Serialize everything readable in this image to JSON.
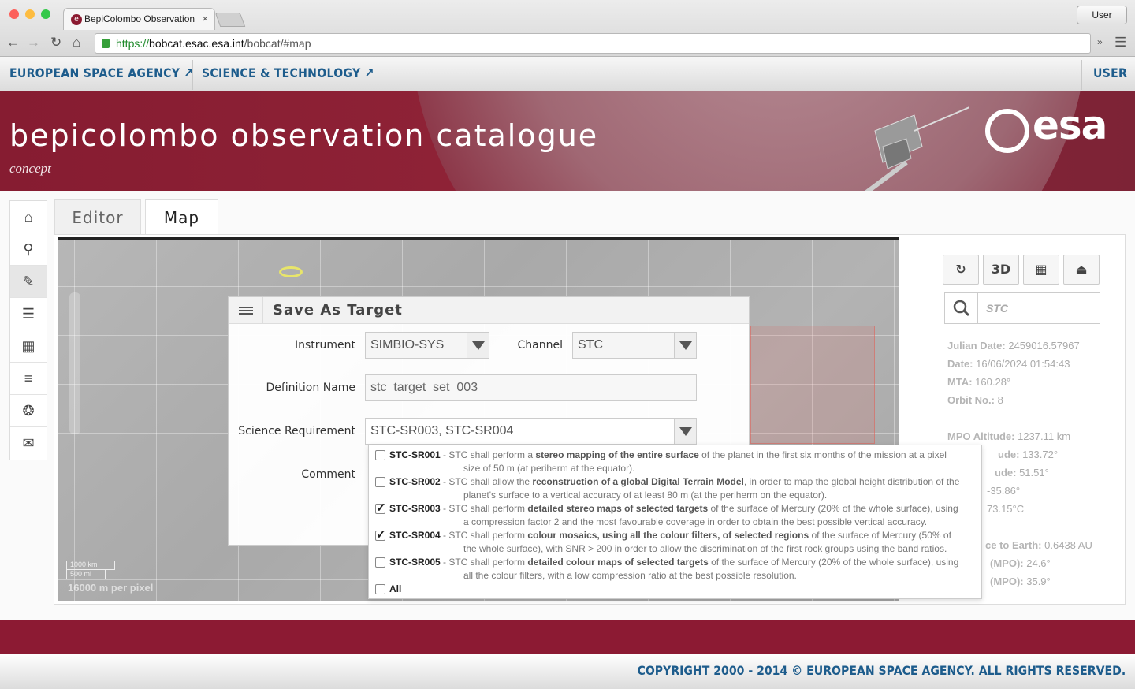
{
  "browser": {
    "tab_title": "BepiColombo Observation",
    "tab_close": "×",
    "user_button": "User",
    "url_protocol": "https://",
    "url_host": "bobcat.esac.esa.int",
    "url_path": "/bobcat/#map",
    "overflow": "»"
  },
  "esa_bar": {
    "link1": "EUROPEAN SPACE AGENCY",
    "link2": "SCIENCE & TECHNOLOGY",
    "user": "USER"
  },
  "banner": {
    "title": "bepicolombo observation catalogue",
    "subtitle": "concept",
    "logo_text": "esa"
  },
  "tabs": {
    "editor": "Editor",
    "map": "Map"
  },
  "sidenav": {
    "icons": [
      "home-icon",
      "search-icon",
      "pencil-icon",
      "list-icon",
      "dashboard-icon",
      "sliders-icon",
      "lifebuoy-icon",
      "mail-icon"
    ]
  },
  "map": {
    "scale_km": "1000 km",
    "scale_mi": "500 mi",
    "resolution": "16000 m per pixel"
  },
  "dialog": {
    "title": "Save As Target",
    "instrument_label": "Instrument",
    "instrument_value": "SIMBIO-SYS",
    "channel_label": "Channel",
    "channel_value": "STC",
    "definition_label": "Definition Name",
    "definition_value": "stc_target_set_003",
    "science_label": "Science Requirement",
    "science_value": "STC-SR003, STC-SR004",
    "comment_label": "Comment"
  },
  "requirements": [
    {
      "code": "STC-SR001",
      "checked": false,
      "pre": " - STC shall perform a ",
      "hl": "stereo mapping of the entire surface",
      "post": " of the planet in the first six months of the mission at a pixel",
      "cont": "size of 50 m (at periherm at the equator)."
    },
    {
      "code": "STC-SR002",
      "checked": false,
      "pre": " - STC shall allow the ",
      "hl": "reconstruction of a global Digital Terrain Model",
      "post": ", in order to map the global height distribution of the",
      "cont": "planet's surface to a vertical accuracy of at least 80 m (at the periherm on the equator)."
    },
    {
      "code": "STC-SR003",
      "checked": true,
      "pre": " - STC shall perform ",
      "hl": "detailed stereo maps of selected targets",
      "post": " of the surface of Mercury (20% of the whole surface), using",
      "cont": "a compression factor 2 and the most favourable coverage in order to obtain the best possible vertical accuracy."
    },
    {
      "code": "STC-SR004",
      "checked": true,
      "pre": " - STC shall perform ",
      "hl": "colour mosaics, using all the colour filters, of selected regions",
      "post": " of the surface of Mercury (50% of",
      "cont": "the whole surface), with SNR > 200 in order to allow the discrimination of the first rock groups using the band ratios."
    },
    {
      "code": "STC-SR005",
      "checked": false,
      "pre": " - STC shall perform ",
      "hl": "detailed colour maps of selected targets",
      "post": " of the surface of Mercury (20% of the whole surface), using",
      "cont": "all the colour filters, with a low compression ratio at the best possible resolution."
    }
  ],
  "req_all": "All",
  "toolbar": {
    "refresh": "refresh-icon",
    "three_d": "3D",
    "layout": "layout-icon",
    "export": "export-icon"
  },
  "search": {
    "placeholder": "STC"
  },
  "info": {
    "julian_label": "Julian Date:",
    "julian": "2459016.57967",
    "date_label": "Date:",
    "date": "16/06/2024 01:54:43",
    "mta_label": "MTA:",
    "mta": "160.28°",
    "orbit_label": "Orbit No.:",
    "orbit": "8",
    "alt_label": "MPO Altitude:",
    "alt": "1237.11 km",
    "lon_label": "ude:",
    "lon": "133.72°",
    "lat_label": "ude:",
    "lat": "51.51°",
    "sza": "-35.86°",
    "temp": "73.15°C",
    "dist_label": "ce to Earth:",
    "dist": "0.6438 AU",
    "mpo1_label": "(MPO):",
    "mpo1": "24.6°",
    "mpo2_label": "(MPO):",
    "mpo2": "35.9°"
  },
  "footer": {
    "copyright": "COPYRIGHT 2000 - 2014 © EUROPEAN SPACE AGENCY. ALL RIGHTS RESERVED."
  }
}
